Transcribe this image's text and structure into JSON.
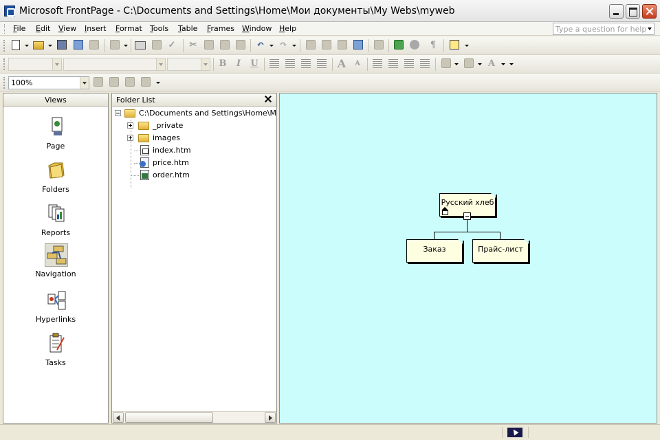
{
  "window": {
    "title": "Microsoft FrontPage - C:\\Documents and Settings\\Home\\Мои документы\\My Webs\\myweb"
  },
  "menu": {
    "items": [
      "File",
      "Edit",
      "View",
      "Insert",
      "Format",
      "Tools",
      "Table",
      "Frames",
      "Window",
      "Help"
    ],
    "help_placeholder": "Type a question for help"
  },
  "toolbar": {
    "zoom": "100%",
    "font_style": "",
    "font_name": "",
    "font_size": ""
  },
  "views": {
    "header": "Views",
    "items": [
      {
        "label": "Page",
        "icon": "page-view-icon"
      },
      {
        "label": "Folders",
        "icon": "folders-view-icon"
      },
      {
        "label": "Reports",
        "icon": "reports-view-icon"
      },
      {
        "label": "Navigation",
        "icon": "navigation-view-icon",
        "selected": true
      },
      {
        "label": "Hyperlinks",
        "icon": "hyperlinks-view-icon"
      },
      {
        "label": "Tasks",
        "icon": "tasks-view-icon"
      }
    ]
  },
  "folder_list": {
    "header": "Folder List",
    "root": "C:\\Documents and Settings\\Home\\Мои до",
    "items": [
      {
        "label": "_private",
        "type": "folder"
      },
      {
        "label": "images",
        "type": "folder"
      },
      {
        "label": "index.htm",
        "type": "home-file"
      },
      {
        "label": "price.htm",
        "type": "file"
      },
      {
        "label": "order.htm",
        "type": "file"
      }
    ]
  },
  "navigation": {
    "root": "Русский хлеб",
    "children": [
      "Заказ",
      "Прайс-лист"
    ]
  },
  "colors": {
    "nav_background": "#ccfdfd",
    "node_fill": "#fefee0"
  }
}
